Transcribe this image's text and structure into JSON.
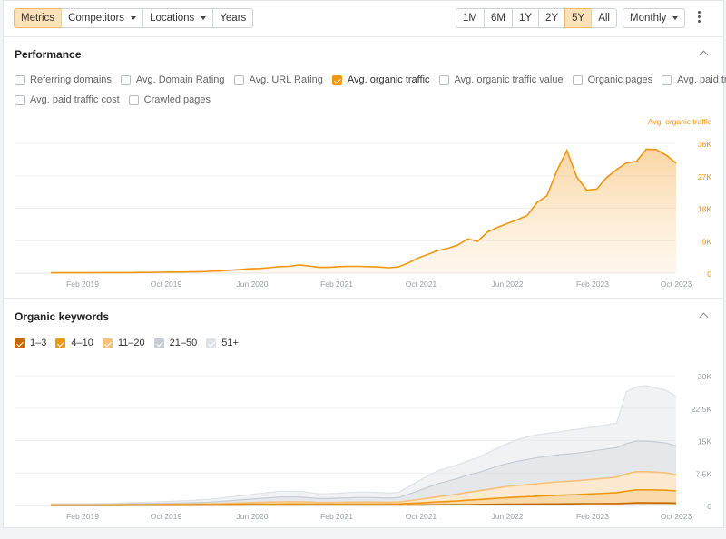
{
  "toolbar": {
    "left_tabs": [
      {
        "label": "Metrics",
        "active": true,
        "caret": false
      },
      {
        "label": "Competitors",
        "active": false,
        "caret": true
      },
      {
        "label": "Locations",
        "active": false,
        "caret": true
      },
      {
        "label": "Years",
        "active": false,
        "caret": false
      }
    ],
    "ranges": [
      {
        "label": "1M",
        "active": false
      },
      {
        "label": "6M",
        "active": false
      },
      {
        "label": "1Y",
        "active": false
      },
      {
        "label": "2Y",
        "active": false
      },
      {
        "label": "5Y",
        "active": true
      },
      {
        "label": "All",
        "active": false
      }
    ],
    "interval": "Monthly",
    "more_icon": "kebab-menu-icon"
  },
  "performance": {
    "title": "Performance",
    "collapse_icon": "chevron-up-icon",
    "metrics_row1": [
      {
        "label": "Referring domains",
        "checked": false
      },
      {
        "label": "Avg. Domain Rating",
        "checked": false
      },
      {
        "label": "Avg. URL Rating",
        "checked": false
      },
      {
        "label": "Avg. organic traffic",
        "checked": true
      },
      {
        "label": "Avg. organic traffic value",
        "checked": false
      },
      {
        "label": "Organic pages",
        "checked": false
      },
      {
        "label": "Avg. paid traffic",
        "checked": false
      }
    ],
    "metrics_row2": [
      {
        "label": "Avg. paid traffic cost",
        "checked": false
      },
      {
        "label": "Crawled pages",
        "checked": false
      }
    ]
  },
  "organic_keywords": {
    "title": "Organic keywords",
    "collapse_icon": "chevron-up-icon",
    "positions": [
      {
        "label": "1–3",
        "checked": true,
        "color": "#c46a00"
      },
      {
        "label": "4–10",
        "checked": true,
        "color": "#f0960f"
      },
      {
        "label": "11–20",
        "checked": true,
        "color": "#f7c078"
      },
      {
        "label": "21–50",
        "checked": true,
        "color": "#c5ccd3"
      },
      {
        "label": "51+",
        "checked": true,
        "color": "#dfe3e7"
      }
    ]
  },
  "colors": {
    "accent": "#f0960f",
    "accent_fill": "#fde1b8",
    "axis_text": "#9aa0a6"
  },
  "chart_data": [
    {
      "type": "area",
      "legend": "Avg. organic traffic",
      "legend_position": "top-right",
      "x_tick_labels": [
        "Feb 2019",
        "Oct 2019",
        "Jun 2020",
        "Feb 2021",
        "Oct 2021",
        "Jun 2022",
        "Feb 2023",
        "Oct 2023"
      ],
      "y_tick_labels": [
        "36K",
        "27K",
        "18K",
        "9K",
        "0"
      ],
      "ylim": [
        0,
        36000
      ],
      "x": [
        "2018-10",
        "2018-11",
        "2018-12",
        "2019-01",
        "2019-02",
        "2019-03",
        "2019-04",
        "2019-05",
        "2019-06",
        "2019-07",
        "2019-08",
        "2019-09",
        "2019-10",
        "2019-11",
        "2019-12",
        "2020-01",
        "2020-02",
        "2020-03",
        "2020-04",
        "2020-05",
        "2020-06",
        "2020-07",
        "2020-08",
        "2020-09",
        "2020-10",
        "2020-11",
        "2020-12",
        "2021-01",
        "2021-02",
        "2021-03",
        "2021-04",
        "2021-05",
        "2021-06",
        "2021-07",
        "2021-08",
        "2021-09",
        "2021-10",
        "2021-11",
        "2021-12",
        "2022-01",
        "2022-02",
        "2022-03",
        "2022-04",
        "2022-05",
        "2022-06",
        "2022-07",
        "2022-08",
        "2022-09",
        "2022-10",
        "2022-11",
        "2022-12",
        "2023-01",
        "2023-02",
        "2023-03",
        "2023-04",
        "2023-05",
        "2023-06",
        "2023-07",
        "2023-08",
        "2023-09",
        "2023-10"
      ],
      "series": [
        {
          "name": "Avg. organic traffic",
          "values": [
            100,
            100,
            100,
            100,
            100,
            150,
            150,
            150,
            150,
            200,
            200,
            250,
            300,
            300,
            350,
            400,
            500,
            600,
            800,
            1000,
            1200,
            1300,
            1500,
            1800,
            1900,
            2300,
            2000,
            1600,
            1600,
            1800,
            1900,
            1900,
            1800,
            1700,
            1500,
            1700,
            2800,
            4200,
            5200,
            6300,
            6900,
            7800,
            9500,
            8800,
            11400,
            12700,
            13800,
            14800,
            16000,
            19600,
            21500,
            28500,
            34000,
            26600,
            23000,
            23300,
            26500,
            28700,
            30600,
            31000,
            34400,
            34300,
            32700,
            30500
          ]
        }
      ]
    },
    {
      "type": "area",
      "stacked": true,
      "x_tick_labels": [
        "Feb 2019",
        "Oct 2019",
        "Jun 2020",
        "Feb 2021",
        "Oct 2021",
        "Jun 2022",
        "Feb 2023",
        "Oct 2023"
      ],
      "y_tick_labels": [
        "30K",
        "22.5K",
        "15K",
        "7.5K",
        "0"
      ],
      "ylim": [
        0,
        30000
      ],
      "series": [
        {
          "name": "1–3",
          "values": [
            50,
            50,
            50,
            50,
            50,
            50,
            50,
            50,
            60,
            60,
            60,
            60,
            60,
            60,
            70,
            80,
            80,
            80,
            90,
            90,
            100,
            100,
            100,
            100,
            100,
            100,
            100,
            100,
            100,
            100,
            100,
            100,
            100,
            100,
            100,
            100,
            110,
            120,
            140,
            160,
            180,
            200,
            220,
            240,
            260,
            280,
            300,
            320,
            330,
            340,
            350,
            360,
            380,
            400,
            420,
            430,
            440,
            450,
            500,
            600,
            600,
            590,
            580,
            550
          ]
        },
        {
          "name": "4–10",
          "values": [
            50,
            50,
            50,
            50,
            60,
            60,
            60,
            70,
            80,
            80,
            80,
            90,
            100,
            100,
            110,
            120,
            130,
            140,
            160,
            180,
            200,
            210,
            220,
            240,
            250,
            260,
            240,
            200,
            200,
            220,
            230,
            240,
            240,
            240,
            230,
            250,
            350,
            450,
            550,
            650,
            750,
            850,
            1000,
            1100,
            1250,
            1400,
            1500,
            1600,
            1700,
            1800,
            1900,
            2000,
            2050,
            2100,
            2200,
            2300,
            2400,
            2500,
            2800,
            3000,
            3000,
            3000,
            2950,
            2800
          ]
        },
        {
          "name": "11–20",
          "values": [
            50,
            50,
            50,
            50,
            60,
            60,
            70,
            80,
            90,
            100,
            100,
            110,
            120,
            130,
            140,
            150,
            170,
            200,
            250,
            300,
            350,
            400,
            450,
            500,
            500,
            500,
            450,
            400,
            400,
            420,
            440,
            460,
            460,
            440,
            420,
            450,
            600,
            800,
            1000,
            1200,
            1400,
            1600,
            1800,
            2000,
            2200,
            2400,
            2600,
            2700,
            2800,
            2900,
            3000,
            3100,
            3150,
            3200,
            3300,
            3400,
            3500,
            3600,
            4000,
            4200,
            4200,
            4100,
            4000,
            3700
          ]
        },
        {
          "name": "21–50",
          "values": [
            100,
            100,
            100,
            100,
            100,
            100,
            120,
            140,
            160,
            180,
            200,
            220,
            250,
            280,
            300,
            350,
            400,
            500,
            600,
            700,
            800,
            900,
            1000,
            1100,
            1100,
            1100,
            1000,
            900,
            900,
            950,
            1000,
            1050,
            1050,
            1000,
            950,
            1000,
            1500,
            2000,
            2500,
            3000,
            3300,
            3600,
            4000,
            4200,
            4600,
            5000,
            5300,
            5600,
            5800,
            6000,
            6100,
            6200,
            6300,
            6400,
            6500,
            6600,
            6700,
            6800,
            7000,
            7100,
            7100,
            7000,
            6900,
            6700
          ]
        },
        {
          "name": "51+",
          "values": [
            150,
            150,
            150,
            150,
            150,
            180,
            200,
            230,
            260,
            300,
            340,
            380,
            420,
            470,
            520,
            580,
            650,
            750,
            850,
            950,
            1050,
            1150,
            1250,
            1350,
            1350,
            1300,
            1200,
            1100,
            1100,
            1150,
            1200,
            1250,
            1250,
            1200,
            1150,
            1200,
            1700,
            2200,
            2700,
            3000,
            3100,
            3200,
            3300,
            3500,
            3800,
            4200,
            4600,
            5000,
            5200,
            5300,
            5300,
            5300,
            5400,
            5500,
            5500,
            5500,
            5600,
            5700,
            12000,
            12500,
            12800,
            12500,
            12200,
            11500
          ]
        }
      ]
    }
  ]
}
